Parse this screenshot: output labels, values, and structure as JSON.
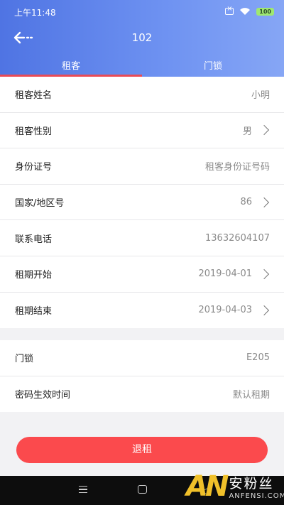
{
  "status_bar": {
    "time": "上午11:48",
    "battery": "100"
  },
  "header": {
    "title": "102"
  },
  "tabs": [
    {
      "label": "租客",
      "active": true
    },
    {
      "label": "门锁",
      "active": false
    }
  ],
  "tenant_section": {
    "rows": [
      {
        "label": "租客姓名",
        "value": "小明",
        "has_arrow": false
      },
      {
        "label": "租客性别",
        "value": "男",
        "has_arrow": true
      },
      {
        "label": "身份证号",
        "value": "租客身份证号码",
        "has_arrow": false
      },
      {
        "label": "国家/地区号",
        "value": "86",
        "has_arrow": true
      },
      {
        "label": "联系电话",
        "value": "13632604107",
        "has_arrow": false
      },
      {
        "label": "租期开始",
        "value": "2019-04-01",
        "has_arrow": true
      },
      {
        "label": "租期结束",
        "value": "2019-04-03",
        "has_arrow": true
      }
    ]
  },
  "lock_section": {
    "rows": [
      {
        "label": "门锁",
        "value": "E205",
        "has_arrow": false
      },
      {
        "label": "密码生效时间",
        "value": "默认租期",
        "has_arrow": false
      }
    ]
  },
  "actions": {
    "checkout_label": "退租"
  },
  "watermark": {
    "logo": "AN",
    "name": "安粉丝",
    "domain": "ANFENSI.COM"
  },
  "colors": {
    "header_start": "#4f74e3",
    "header_end": "#86a6f5",
    "tab_indicator": "#e94b56",
    "button": "#fb4a4d"
  }
}
